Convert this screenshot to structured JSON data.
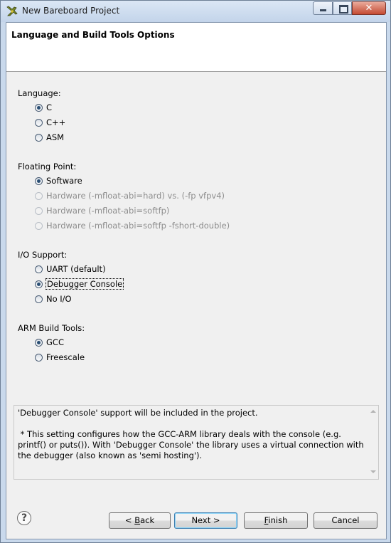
{
  "window": {
    "title": "New Bareboard Project"
  },
  "header": {
    "title": "Language and Build Tools Options"
  },
  "language": {
    "label": "Language:",
    "options": [
      {
        "label": "C",
        "selected": true
      },
      {
        "label": "C++",
        "selected": false
      },
      {
        "label": "ASM",
        "selected": false
      }
    ]
  },
  "floating_point": {
    "label": "Floating Point:",
    "options": [
      {
        "label": "Software",
        "selected": true,
        "enabled": true
      },
      {
        "label": "Hardware (-mfloat-abi=hard) vs. (-fp vfpv4)",
        "selected": false,
        "enabled": false
      },
      {
        "label": "Hardware (-mfloat-abi=softfp)",
        "selected": false,
        "enabled": false
      },
      {
        "label": "Hardware (-mfloat-abi=softfp -fshort-double)",
        "selected": false,
        "enabled": false
      }
    ]
  },
  "io_support": {
    "label": "I/O Support:",
    "options": [
      {
        "label": "UART (default)",
        "selected": false
      },
      {
        "label": "Debugger Console",
        "selected": true
      },
      {
        "label": "No I/O",
        "selected": false
      }
    ]
  },
  "build_tools": {
    "label": "ARM Build Tools:",
    "options": [
      {
        "label": "GCC",
        "selected": true
      },
      {
        "label": "Freescale",
        "selected": false
      }
    ]
  },
  "description": {
    "text": "'Debugger Console' support will be included in the project.\n\n * This setting configures how the GCC-ARM library deals with the console (e.g. printf() or puts()). With 'Debugger Console' the library uses a virtual connection with the debugger (also known as 'semi hosting')."
  },
  "buttons": {
    "back": {
      "prefix": "< ",
      "mnemonic": "B",
      "rest": "ack"
    },
    "next": "Next >",
    "finish": {
      "mnemonic": "F",
      "rest": "inish"
    },
    "cancel": "Cancel"
  },
  "icons": {
    "app": "bareboard-project-icon",
    "help": "help-icon"
  }
}
